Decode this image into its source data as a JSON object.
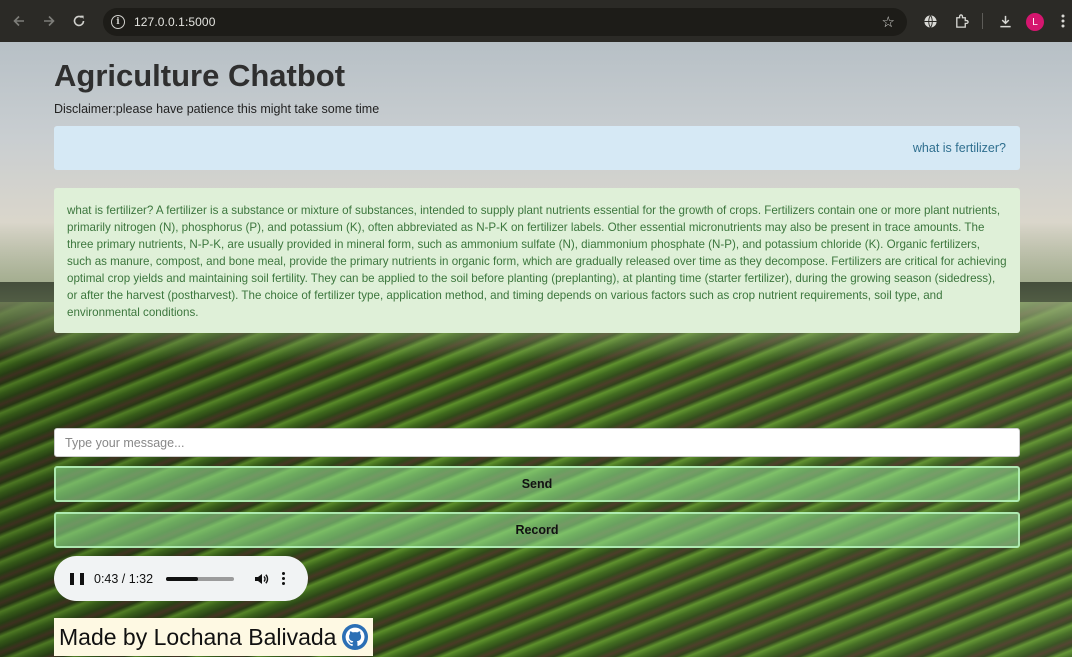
{
  "browser": {
    "url": "127.0.0.1:5000",
    "profile_initial": "L"
  },
  "page": {
    "title": "Agriculture Chatbot",
    "disclaimer": "Disclaimer:please have patience this might take some time"
  },
  "chat": {
    "user_message": "what is fertilizer?",
    "bot_message": "what is fertilizer? A fertilizer is a substance or mixture of substances, intended to supply plant nutrients essential for the growth of crops. Fertilizers contain one or more plant nutrients, primarily nitrogen (N), phosphorus (P), and potassium (K), often abbreviated as N-P-K on fertilizer labels. Other essential micronutrients may also be present in trace amounts. The three primary nutrients, N-P-K, are usually provided in mineral form, such as ammonium sulfate (N), diammonium phosphate (N-P), and potassium chloride (K). Organic fertilizers, such as manure, compost, and bone meal, provide the primary nutrients in organic form, which are gradually released over time as they decompose. Fertilizers are critical for achieving optimal crop yields and maintaining soil fertility. They can be applied to the soil before planting (preplanting), at planting time (starter fertilizer), during the growing season (sidedress), or after the harvest (postharvest). The choice of fertilizer type, application method, and timing depends on various factors such as crop nutrient requirements, soil type, and environmental conditions."
  },
  "input": {
    "placeholder": "Type your message...",
    "value": ""
  },
  "buttons": {
    "send_label": "Send",
    "record_label": "Record"
  },
  "audio": {
    "time_display": "0:43 / 1:32",
    "progress_fraction": 0.467
  },
  "footer": {
    "text": "Made by Lochana Balivada"
  },
  "colors": {
    "user_bubble": "#d6e9f5",
    "bot_bubble": "#dff0d8",
    "button_green": "#98e898",
    "footer_bg": "#fef9e3",
    "avatar": "#d5166f"
  },
  "icons": {
    "back": "arrow-left-icon",
    "forward": "arrow-right-icon",
    "reload": "reload-icon",
    "site_info": "info-icon",
    "bookmark": "star-icon",
    "translate": "globe-icon",
    "extensions": "puzzle-icon",
    "downloads": "download-icon",
    "menu": "kebab-menu-icon",
    "audio_pause": "pause-icon",
    "audio_volume": "volume-icon",
    "audio_more": "more-vertical-icon",
    "github": "github-icon"
  }
}
